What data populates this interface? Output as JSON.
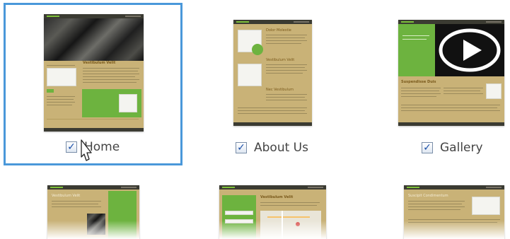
{
  "pages": [
    {
      "label": "Home",
      "checked": true,
      "selected": true,
      "heading": "Vestibulum Velit"
    },
    {
      "label": "About Us",
      "checked": true,
      "selected": false,
      "headings": [
        "Dolor Molestie",
        "Vestibulum Velit",
        "Nec Vestibulum"
      ]
    },
    {
      "label": "Gallery",
      "checked": true,
      "selected": false,
      "heading": "Suspendisse Duis"
    }
  ],
  "partial_pages": [
    {
      "heading": "Vestibulum Velit"
    },
    {
      "heading": "Vestibulum Velit"
    },
    {
      "heading": "Suscipit Condimentum"
    }
  ],
  "check_glyph": "✓",
  "colors": {
    "accent": "#4a98da",
    "thumb_bg": "#c9b277",
    "green": "#6db33f",
    "dark_bar": "#3b3b32"
  }
}
